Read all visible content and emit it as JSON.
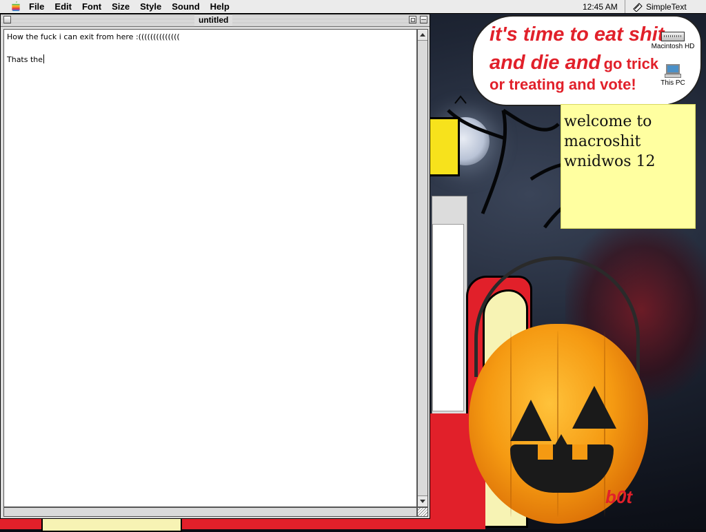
{
  "menubar": {
    "apple_icon": "apple-logo",
    "items": [
      "File",
      "Edit",
      "Font",
      "Size",
      "Style",
      "Sound",
      "Help"
    ],
    "clock": "12:45 AM",
    "active_app": "SimpleText"
  },
  "window": {
    "title": "untitled",
    "lines": [
      "How the fuck i can exit from here :((((((((((((((",
      "",
      "Thats the"
    ]
  },
  "desktop": {
    "bubble": {
      "line1": "it's time to eat shit",
      "line2a": "and die and",
      "line2b": "go trick",
      "line3": "or treating and vote!"
    },
    "sticky": "welcome to\nmacroshit\nwnidwos 12",
    "icons": [
      {
        "label": "Macintosh HD",
        "icon": "hard-drive-icon"
      },
      {
        "label": "This PC",
        "icon": "computer-icon"
      }
    ],
    "overlay_text": "b0t"
  },
  "colors": {
    "menubar": "#ebebeb",
    "accent_red": "#e1202a",
    "sticky": "#ffffa0",
    "pumpkin": "#f59a12"
  }
}
